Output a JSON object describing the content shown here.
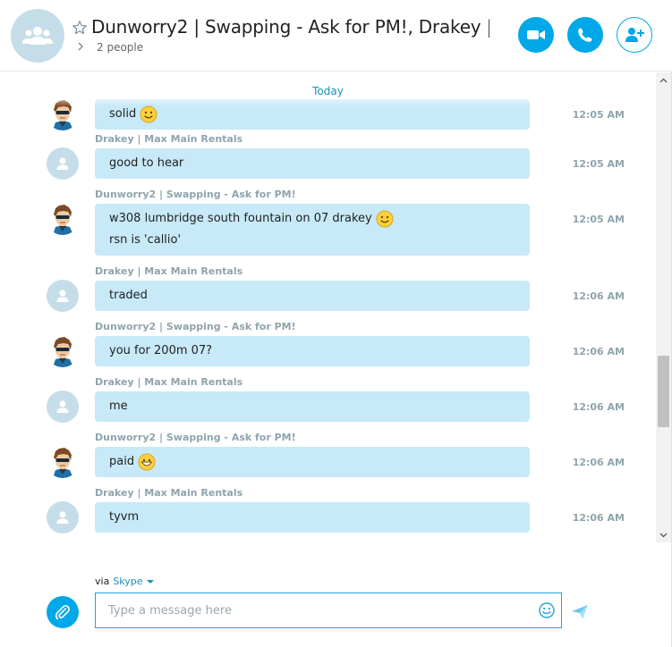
{
  "header": {
    "title": "Dunworry2 | Swapping - Ask for PM!, Drakey |...",
    "subtitle": "2 people"
  },
  "conversation": {
    "day_label": "Today",
    "messages": [
      {
        "sender": "",
        "avatar": "cartoon",
        "lines": [
          "solid"
        ],
        "emoji": "smile-emoji",
        "time": "12:05 AM"
      },
      {
        "sender": "Drakey | Max Main Rentals",
        "avatar": "default",
        "lines": [
          "good to hear"
        ],
        "time": "12:05 AM"
      },
      {
        "sender": "Dunworry2 | Swapping - Ask for PM!",
        "avatar": "cartoon",
        "lines": [
          "w308 lumbridge south fountain on 07 drakey",
          "rsn is 'callio'"
        ],
        "emoji": "smile-emoji",
        "time": "12:05 AM"
      },
      {
        "sender": "Drakey | Max Main Rentals",
        "avatar": "default",
        "lines": [
          "traded"
        ],
        "time": "12:06 AM"
      },
      {
        "sender": "Dunworry2 | Swapping - Ask for PM!",
        "avatar": "cartoon",
        "lines": [
          "you for 200m 07?"
        ],
        "time": "12:06 AM"
      },
      {
        "sender": "Drakey | Max Main Rentals",
        "avatar": "default",
        "lines": [
          "me"
        ],
        "time": "12:06 AM"
      },
      {
        "sender": "Dunworry2 | Swapping - Ask for PM!",
        "avatar": "cartoon",
        "lines": [
          "paid"
        ],
        "emoji": "laugh-emoji",
        "time": "12:06 AM"
      },
      {
        "sender": "Drakey | Max Main Rentals",
        "avatar": "default",
        "lines": [
          "tyvm"
        ],
        "time": "12:06 AM"
      }
    ]
  },
  "composer": {
    "via_label": "via",
    "via_service": "Skype",
    "placeholder": "Type a message here"
  },
  "colors": {
    "accent": "#00a8e8",
    "bubble": "#c7e9f8",
    "meta_text": "#8fa4ad",
    "link": "#1a8fbf"
  },
  "icons": [
    "group-icon",
    "star-icon",
    "chevron-right-icon",
    "video-icon",
    "phone-icon",
    "add-person-icon",
    "default-user-icon",
    "paperclip-icon",
    "emoji-picker-icon",
    "send-icon"
  ]
}
